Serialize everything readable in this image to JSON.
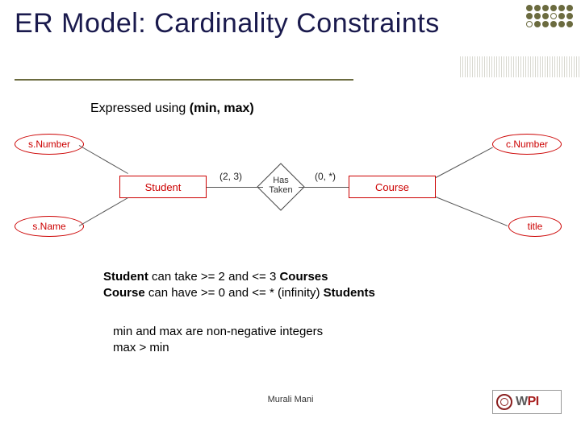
{
  "title": "ER Model: Cardinality Constraints",
  "subhead": {
    "prefix": "Expressed using ",
    "bold": "(min, max)"
  },
  "diagram": {
    "attributes": {
      "sNumber": "s.Number",
      "sName": "s.Name",
      "cNumber": "c.Number",
      "title": "title"
    },
    "entities": {
      "student": "Student",
      "course": "Course"
    },
    "relationship": {
      "line1": "Has",
      "line2": "Taken"
    },
    "cardinality": {
      "studentSide": "(2, 3)",
      "courseSide": "(0, *)"
    }
  },
  "explain": {
    "l1a": "Student",
    "l1b": " can take >= 2 and <= 3 ",
    "l1c": "Courses",
    "l2a": "Course",
    "l2b": " can have >= 0 and <= * (infinity) ",
    "l2c": "Students"
  },
  "rules": {
    "r1": "min and max are non-negative integers",
    "r2": "max > min"
  },
  "footer": "Murali Mani",
  "logo": {
    "text1": "W",
    "text2": "PI"
  }
}
